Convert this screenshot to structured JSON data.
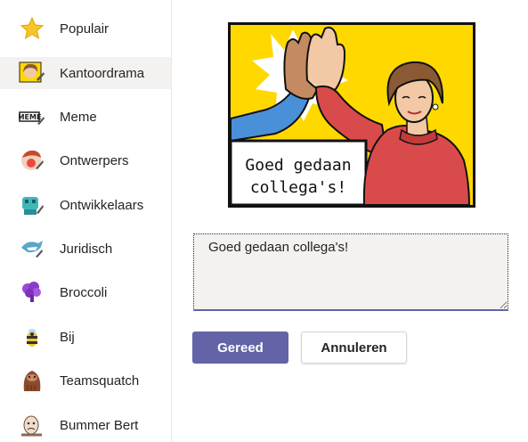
{
  "sidebar": {
    "items": [
      {
        "label": "Populair",
        "icon": "star-icon"
      },
      {
        "label": "Kantoordrama",
        "icon": "woman-sticker-icon"
      },
      {
        "label": "Meme",
        "icon": "meme-icon"
      },
      {
        "label": "Ontwerpers",
        "icon": "designer-sticker-icon"
      },
      {
        "label": "Ontwikkelaars",
        "icon": "developer-sticker-icon"
      },
      {
        "label": "Juridisch",
        "icon": "shark-sticker-icon"
      },
      {
        "label": "Broccoli",
        "icon": "broccoli-sticker-icon"
      },
      {
        "label": "Bij",
        "icon": "bee-sticker-icon"
      },
      {
        "label": "Teamsquatch",
        "icon": "bigfoot-sticker-icon"
      },
      {
        "label": "Bummer Bert",
        "icon": "bert-sticker-icon"
      }
    ],
    "selected": "Kantoordrama"
  },
  "preview": {
    "caption_line1": "Goed gedaan",
    "caption_line2": "collega's!"
  },
  "caption_input": {
    "value": "Goed gedaan collega's!"
  },
  "buttons": {
    "done": "Gereed",
    "cancel": "Annuleren"
  },
  "colors": {
    "accent": "#6264a7",
    "comic_yellow": "#ffd800",
    "sidebar_selected": "#f3f2f1"
  }
}
